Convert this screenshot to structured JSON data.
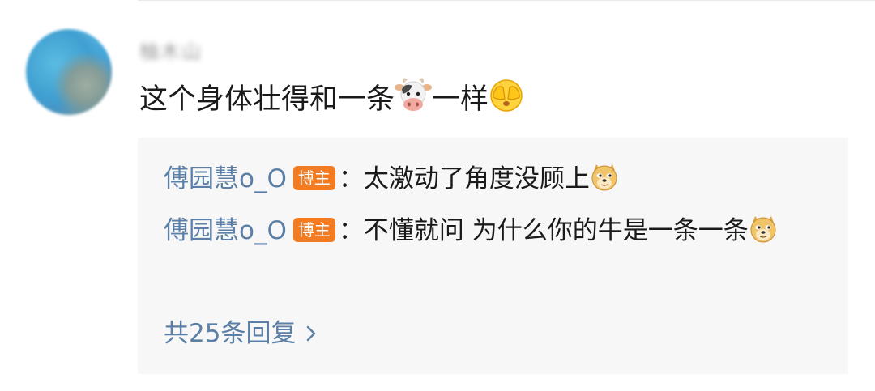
{
  "comment": {
    "username": "柚木山",
    "text_part1": "这个身体壮得和一条",
    "text_part2": "一样",
    "emoji_1": "cow-face-icon",
    "emoji_2": "covering-face-icon"
  },
  "replies": [
    {
      "author": "傅园慧o_O",
      "badge": "博主",
      "separator": "：",
      "text": "太激动了角度没顾上",
      "emoji": "doge-icon"
    },
    {
      "author": "傅园慧o_O",
      "badge": "博主",
      "separator": "：",
      "text": "不懂就问 为什么你的牛是一条一条",
      "emoji": "doge-icon"
    }
  ],
  "more_replies_label": "共25条回复",
  "colors": {
    "link_blue": "#5b7fa6",
    "badge_orange": "#f37c22",
    "reply_bg": "#f7f7f7"
  }
}
